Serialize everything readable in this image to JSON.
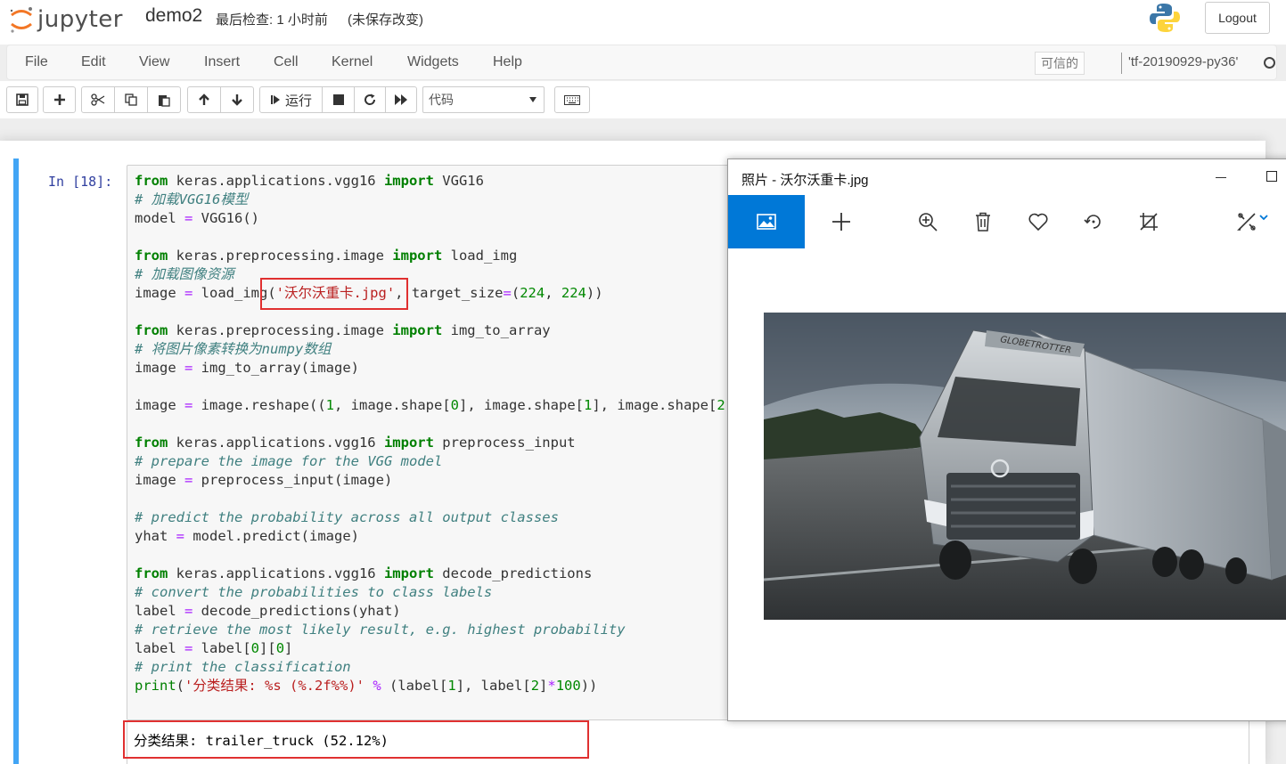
{
  "header": {
    "logo_text": "jupyter",
    "notebook_name": "demo2",
    "checkpoint": "最后检查: 1 小时前",
    "dirty_status": "(未保存改变)",
    "logout_label": "Logout"
  },
  "menubar": {
    "items": [
      "File",
      "Edit",
      "View",
      "Insert",
      "Cell",
      "Kernel",
      "Widgets",
      "Help"
    ],
    "trusted_label": "可信的",
    "kernel_name": "'tf-20190929-py36'"
  },
  "toolbar": {
    "run_label": "运行",
    "cell_type": "代码"
  },
  "cell": {
    "prompt": "In  [18]:",
    "output": "分类结果: trailer_truck (52.12%)"
  },
  "photo_viewer": {
    "title": "照片 - 沃尔沃重卡.jpg",
    "truck_brand_text": "GLOBETROTTER"
  },
  "colors": {
    "cell_border": "#42a5f5",
    "highlight_box": "#e03030",
    "photo_active_tab": "#0078d7"
  }
}
